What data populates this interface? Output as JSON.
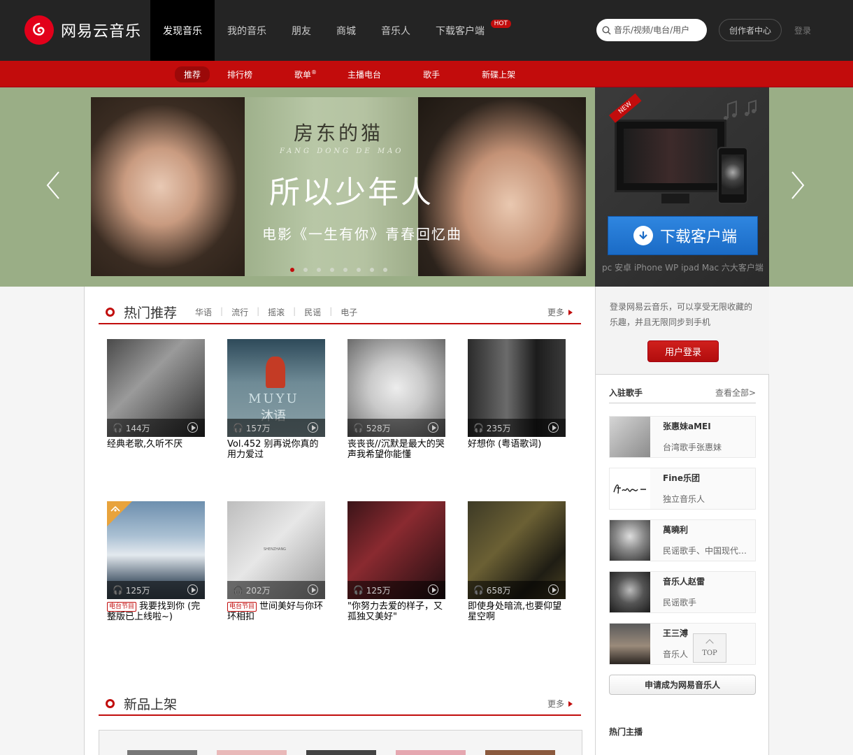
{
  "brand": {
    "name": "网易云音乐"
  },
  "nav": {
    "items": [
      "发现音乐",
      "我的音乐",
      "朋友",
      "商城",
      "音乐人",
      "下载客户端"
    ],
    "hot_badge": "HOT",
    "search_placeholder": "音乐/视频/电台/用户",
    "creator_center": "创作者中心",
    "login": "登录"
  },
  "subnav": {
    "items": [
      "推荐",
      "排行榜",
      "歌单",
      "主播电台",
      "歌手",
      "新碟上架"
    ],
    "playlist_mark": "®"
  },
  "banner": {
    "title": "房东的猫",
    "subtitle": "FANG DONG DE MAO",
    "big_text": "所以少年人",
    "tagline": "电影《一生有你》青春回忆曲",
    "dot_count": 8,
    "active_dot": 0
  },
  "download": {
    "new_tag": "NEW",
    "button": "下载客户端",
    "caption": "pc 安卓 iPhone WP ipad Mac 六大客户端"
  },
  "hot": {
    "title": "热门推荐",
    "tags": [
      "华语",
      "流行",
      "摇滚",
      "民谣",
      "电子"
    ],
    "more": "更多",
    "playlists": [
      {
        "count": "144万",
        "name": "经典老歌,久听不厌",
        "radio": false
      },
      {
        "count": "157万",
        "name": "Vol.452 别再说你真的用力爱过",
        "radio": false
      },
      {
        "count": "528万",
        "name": "丧丧丧//沉默是最大的哭声我希望你能懂",
        "radio": false
      },
      {
        "count": "235万",
        "name": "好想你 (粤语歌词)",
        "radio": false
      },
      {
        "count": "125万",
        "name": "我要找到你 (完整版已上线啦~)",
        "radio": true
      },
      {
        "count": "202万",
        "name": "世间美好与你环环相扣",
        "radio": true
      },
      {
        "count": "125万",
        "name": "\"你努力去爱的样子，又孤独又美好\"",
        "radio": false
      },
      {
        "count": "658万",
        "name": "即使身处暗流,也要仰望星空啊",
        "radio": false
      }
    ],
    "radio_tag": "电台节目",
    "cover_text_2": "MUYU",
    "cover_text_2b": "沐语",
    "cover_text_6": "SHENZHANG"
  },
  "new_albums": {
    "title": "新品上架",
    "more": "更多"
  },
  "side": {
    "login_text": "登录网易云音乐，可以享受无限收藏的乐趣，并且无限同步到手机",
    "login_button": "用户登录",
    "artists_title": "入驻歌手",
    "view_all": "查看全部>",
    "artists": [
      {
        "name": "张惠妹aMEI",
        "desc": "台湾歌手张惠妹"
      },
      {
        "name": "Fine乐团",
        "desc": "独立音乐人"
      },
      {
        "name": "萬曉利",
        "desc": "民谣歌手、中国现代民谣的代表人物之一"
      },
      {
        "name": "音乐人赵雷",
        "desc": "民谣歌手"
      },
      {
        "name": "王三溥",
        "desc": "音乐人"
      }
    ],
    "apply": "申请成为网易音乐人",
    "anchors_title": "热门主播"
  },
  "back_to_top": "TOP"
}
